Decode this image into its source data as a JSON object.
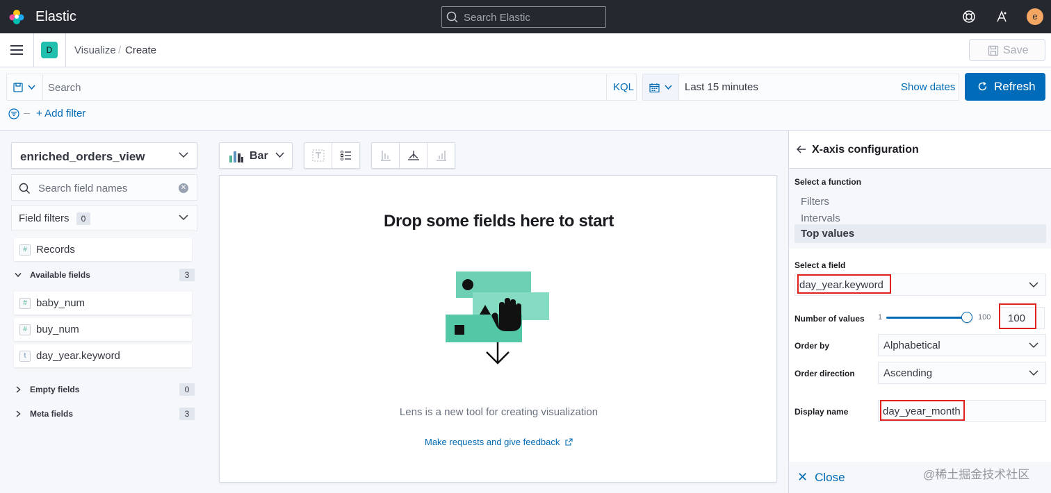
{
  "header": {
    "brand": "Elastic",
    "search_placeholder": "Search Elastic",
    "avatar_letter": "e"
  },
  "nav": {
    "space_letter": "D",
    "breadcrumb": [
      "Visualize",
      "Create"
    ],
    "save_label": "Save"
  },
  "query": {
    "search_placeholder": "Search",
    "language": "KQL",
    "date_range": "Last 15 minutes",
    "show_dates": "Show dates",
    "refresh_label": "Refresh",
    "add_filter": "+ Add filter"
  },
  "sidebar": {
    "index_pattern": "enriched_orders_view",
    "field_search_placeholder": "Search field names",
    "field_filters_label": "Field filters",
    "field_filters_count": "0",
    "records": {
      "type": "#",
      "name": "Records"
    },
    "available": {
      "label": "Available fields",
      "count": "3"
    },
    "fields": [
      {
        "type": "#",
        "name": "baby_num"
      },
      {
        "type": "#",
        "name": "buy_num"
      },
      {
        "type": "t",
        "name": "day_year.keyword"
      }
    ],
    "empty": {
      "label": "Empty fields",
      "count": "0"
    },
    "meta": {
      "label": "Meta fields",
      "count": "3"
    }
  },
  "workspace": {
    "chart_type": "Bar",
    "title": "Drop some fields here to start",
    "description": "Lens is a new tool for creating visualization",
    "feedback_link": "Make requests and give feedback"
  },
  "flyout": {
    "title": "X-axis configuration",
    "select_function_label": "Select a function",
    "functions": [
      "Filters",
      "Intervals",
      "Top values"
    ],
    "selected_function": "Top values",
    "select_field_label": "Select a field",
    "selected_field": "day_year.keyword",
    "number_of_values_label": "Number of values",
    "slider_min": "1",
    "slider_max": "100",
    "slider_level": 1.0,
    "number_of_values": "100",
    "order_by_label": "Order by",
    "order_by": "Alphabetical",
    "order_direction_label": "Order direction",
    "order_direction": "Ascending",
    "display_name_label": "Display name",
    "display_name": "day_year_month",
    "close_label": "Close"
  },
  "watermark": "@稀土掘金技术社区",
  "colors": {
    "accent": "#006bb8",
    "highlight": "#e0201b",
    "header_bg": "#25282f",
    "teal": "#20bfae"
  }
}
